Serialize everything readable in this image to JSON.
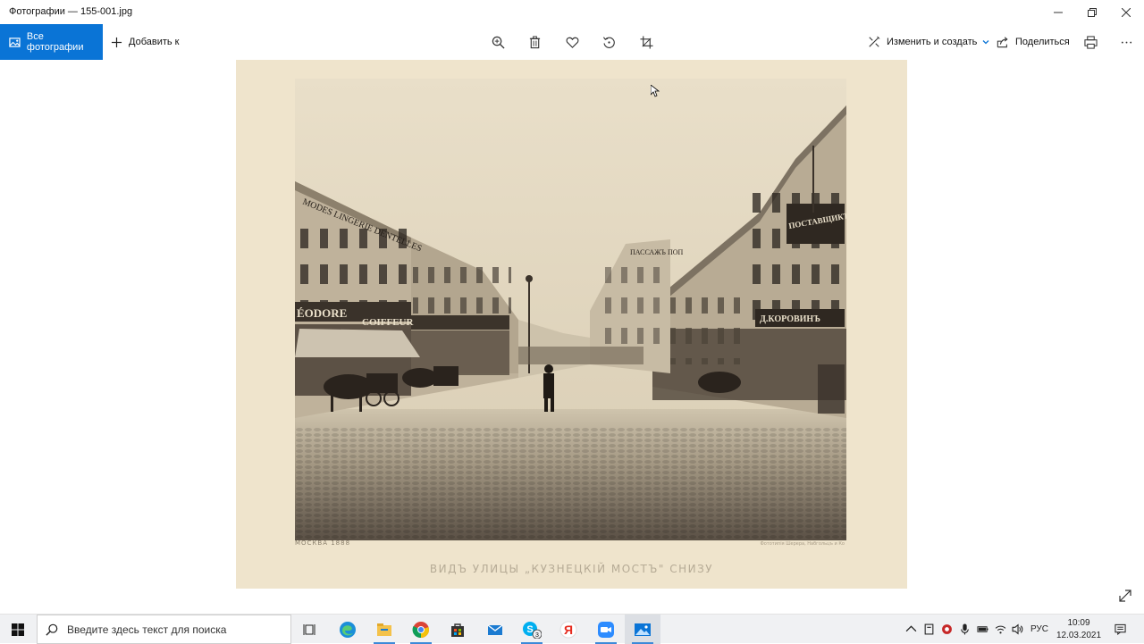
{
  "window": {
    "title": "Фотографии — 155-001.jpg"
  },
  "toolbar": {
    "all_photos_label": "Все фотографии",
    "add_to_label": "Добавить к",
    "edit_create_label": "Изменить и создать",
    "share_label": "Поделиться",
    "accent_color": "#0a74d6"
  },
  "photo": {
    "caption_main": "ВИДЪ УЛИЦЫ „КУЗНЕЦКІЙ МОСТЪ\" СНИЗУ",
    "caption_left": "МОСКВА 1888",
    "caption_right": "Фототипія Шерера, Набгольцъ и Ко",
    "signs": {
      "left_top": "MODES LINGERIE DENTELLES",
      "left_mid1": "ÉODORE",
      "left_mid2": "COIFFEUR",
      "right_top": "ПОСТАВЩИКЪ ДВ. ВЫ",
      "right_mid": "Д.КОРОВИНЪ",
      "center": "ПАССАЖЪ ПОП"
    }
  },
  "taskbar": {
    "search_placeholder": "Введите здесь текст для поиска",
    "skype_badge": "3",
    "language": "РУС",
    "time": "10:09",
    "date": "12.03.2021"
  }
}
